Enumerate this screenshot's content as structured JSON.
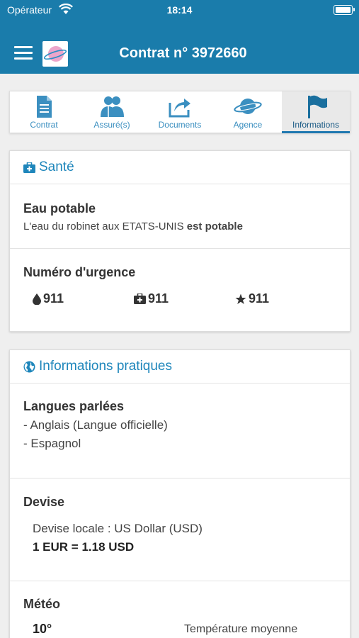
{
  "status_bar": {
    "carrier": "Opérateur",
    "time": "18:14"
  },
  "header": {
    "title": "Contrat n° 3972660",
    "bg_color": "#1a7cab"
  },
  "tabs": [
    {
      "label": "Contrat",
      "icon": "document-icon",
      "active": false
    },
    {
      "label": "Assuré(s)",
      "icon": "users-icon",
      "active": false
    },
    {
      "label": "Documents",
      "icon": "share-icon",
      "active": false
    },
    {
      "label": "Agence",
      "icon": "planet-icon",
      "active": false
    },
    {
      "label": "Informations",
      "icon": "flag-icon",
      "active": true
    }
  ],
  "sante": {
    "title": "Santé",
    "eau": {
      "title": "Eau potable",
      "text_prefix": "L'eau du robinet aux ETATS-UNIS ",
      "text_bold": "est potable"
    },
    "urgence": {
      "title": "Numéro d'urgence",
      "fire": "911",
      "medical": "911",
      "police": "911"
    }
  },
  "infos": {
    "title": "Informations pratiques",
    "langues": {
      "title": "Langues parlées",
      "items": [
        "- Anglais (Langue officielle)",
        "- Espagnol"
      ]
    },
    "devise": {
      "title": "Devise",
      "locale": "Devise locale : US Dollar (USD)",
      "rate": "1 EUR = 1.18 USD"
    },
    "meteo": {
      "title": "Météo",
      "temp": "10°",
      "label": "Température moyenne"
    }
  },
  "colors": {
    "accent": "#1e86bb",
    "tab_icon": "#3b8fc0"
  }
}
